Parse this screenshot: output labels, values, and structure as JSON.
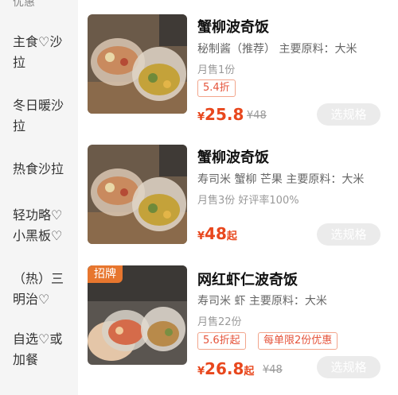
{
  "sidebar": {
    "partial_top": "优惠",
    "categories": [
      {
        "line1": "主食♡沙",
        "line2": "拉"
      },
      {
        "line1": "冬日暖沙",
        "line2": "拉"
      },
      {
        "line1": "热食沙拉",
        "line2": ""
      },
      {
        "line1": "轻功略♡",
        "line2": "小黑板♡"
      },
      {
        "line1": "（热）三",
        "line2": "明治♡"
      },
      {
        "line1": "自选♡或",
        "line2": "加餐"
      }
    ]
  },
  "products": [
    {
      "title": "蟹柳波奇饭",
      "desc": "秘制酱（推荐） 主要原料：大米",
      "sales": "月售1份",
      "discount_tag": "5.4折",
      "price": "25.8",
      "price_prefix": "¥",
      "original_price": "¥48",
      "spec_button": "选规格"
    },
    {
      "title": "蟹柳波奇饭",
      "desc": "寿司米 蟹柳 芒果 主要原料：大米",
      "sales": "月售3份 好评率100%",
      "price": "48",
      "price_prefix": "¥",
      "price_suffix": "起",
      "spec_button": "选规格"
    },
    {
      "badge": "招牌",
      "title": "网红虾仁波奇饭",
      "desc": "寿司米 虾 主要原料：大米",
      "sales": "月售22份",
      "discount_tag": "5.6折起",
      "limit_tag": "每单限2份优惠",
      "price": "26.8",
      "price_prefix": "¥",
      "price_suffix": "起",
      "original_price": "¥48",
      "spec_button": "选规格"
    }
  ],
  "colors": {
    "price": "#e8471d",
    "badge": "#e7762e",
    "sidebar_bg": "#f5f5f5",
    "button_bg": "#ebebeb"
  }
}
